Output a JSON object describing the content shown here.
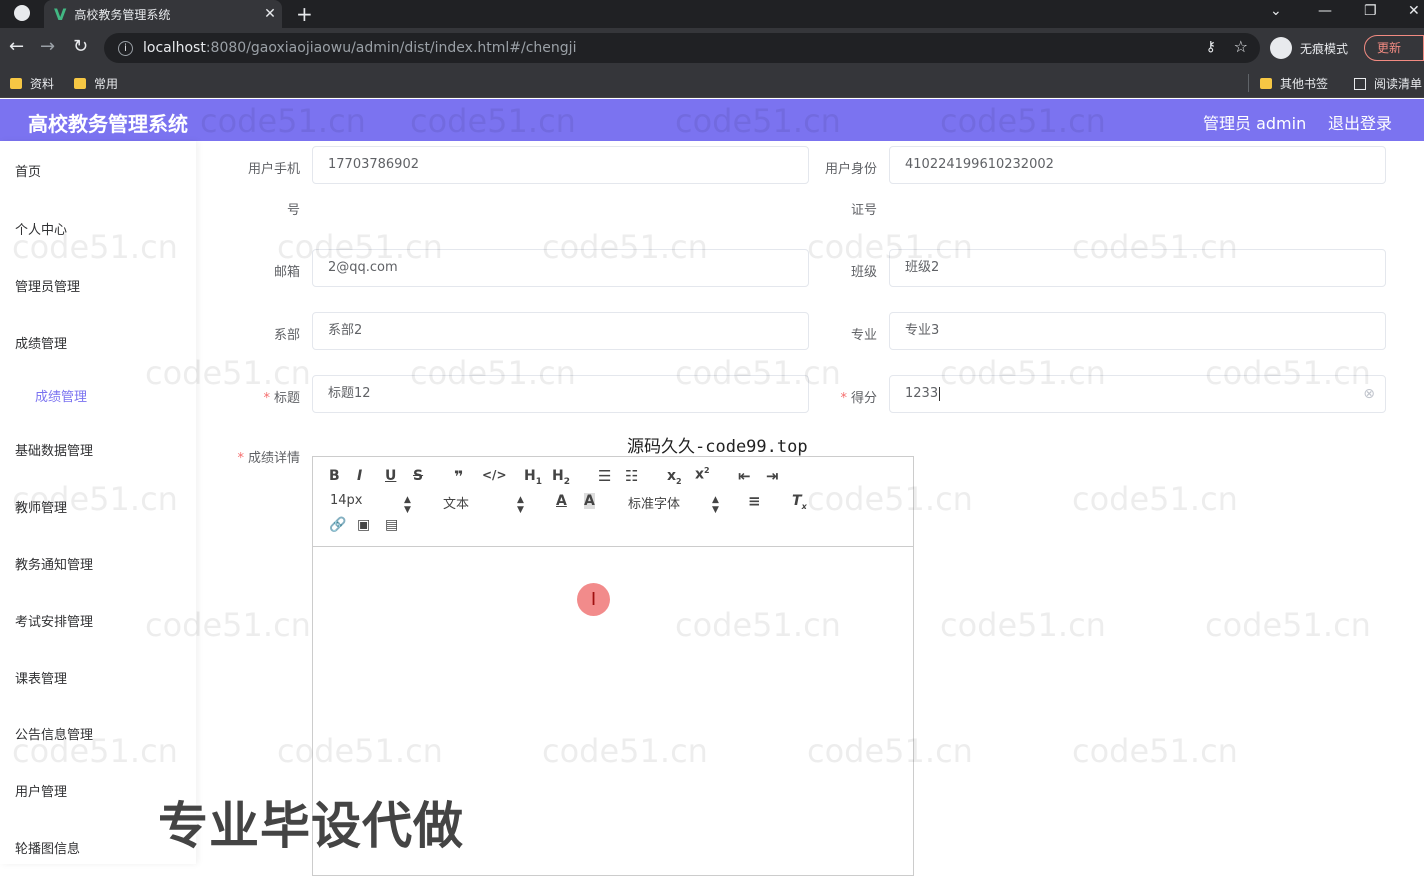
{
  "browser": {
    "tab_title": "高校教务管理系统",
    "tab_close": "✕",
    "new_tab": "+",
    "url_host": "localhost",
    "url_path": ":8080/gaoxiaojiaowu/admin/dist/index.html#/chengji",
    "incognito_label": "无痕模式",
    "update_label": "更新",
    "bookmarks": [
      "资料",
      "常用"
    ],
    "bookmarks_right": [
      "其他书签",
      "阅读清单"
    ]
  },
  "header": {
    "title": "高校教务管理系统",
    "admin_label": "管理员 admin",
    "logout": "退出登录"
  },
  "sidebar": {
    "items": [
      "首页",
      "个人中心",
      "管理员管理",
      "成绩管理",
      "成绩管理",
      "基础数据管理",
      "教师管理",
      "教务通知管理",
      "考试安排管理",
      "课表管理",
      "公告信息管理",
      "用户管理",
      "轮播图信息"
    ]
  },
  "form": {
    "phone_label_1": "用户手机",
    "phone_label_2": "号",
    "phone_value": "17703786902",
    "idcard_label_1": "用户身份",
    "idcard_label_2": "证号",
    "idcard_value": "410224199610232002",
    "email_label": "邮箱",
    "email_value": "2@qq.com",
    "class_label": "班级",
    "class_value": "班级2",
    "dept_label": "系部",
    "dept_value": "系部2",
    "major_label": "专业",
    "major_value": "专业3",
    "title_label": "标题",
    "title_value": "标题12",
    "score_label": "得分",
    "score_value": "1233",
    "detail_label": "成绩详情",
    "required_mark": "*"
  },
  "editor": {
    "font_size": "14px",
    "text_type": "文本",
    "font_family": "标准字体",
    "icons": [
      "bold-icon",
      "italic-icon",
      "underline-icon",
      "strike-icon",
      "quote-icon",
      "code-icon",
      "h1-icon",
      "h2-icon",
      "ordered-list-icon",
      "bullet-list-icon",
      "subscript-icon",
      "superscript-icon",
      "outdent-icon",
      "indent-icon",
      "font-color-icon",
      "background-color-icon",
      "align-icon",
      "clear-format-icon",
      "link-icon",
      "image-icon",
      "video-icon"
    ]
  },
  "overlays": {
    "watermark_text": "code51.cn",
    "top_text": "源码久久-code99.top",
    "bottom_text": "专业毕设代做"
  }
}
